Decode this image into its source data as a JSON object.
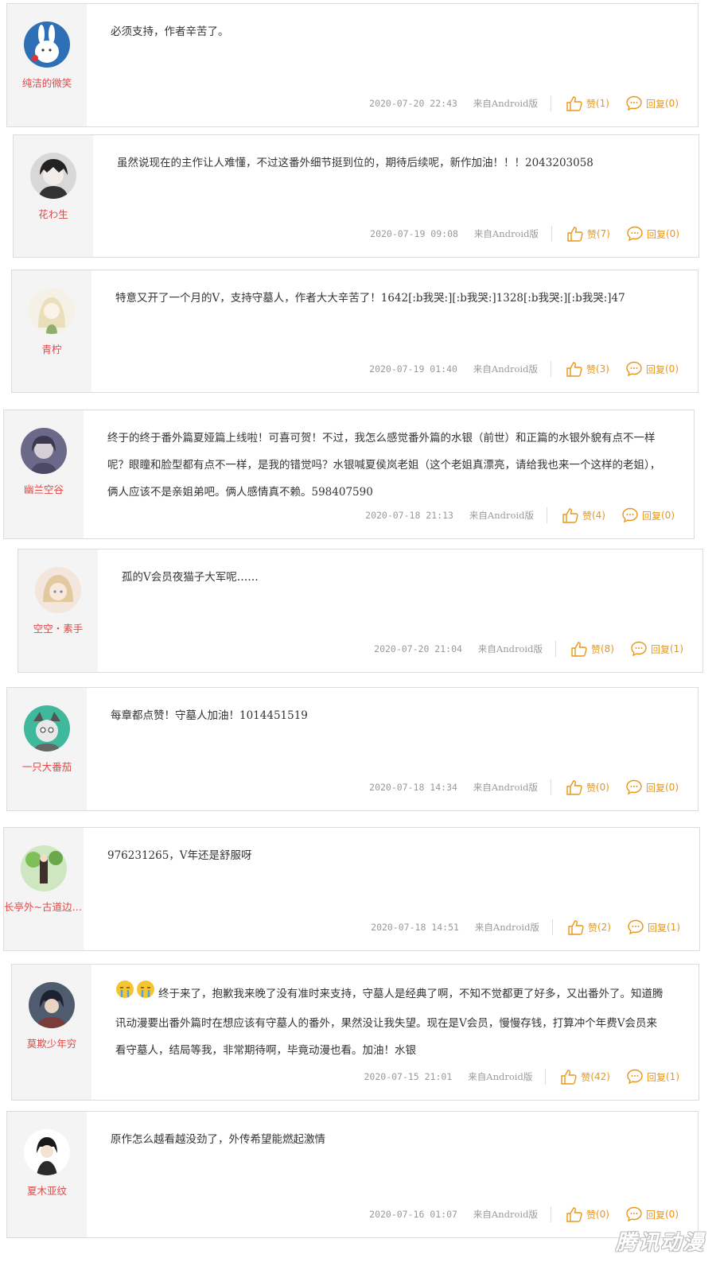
{
  "comments": [
    {
      "user": "纯洁的微笑",
      "text": "必须支持，作者辛苦了。",
      "time": "2020-07-20 22:43",
      "source": "来自Android版",
      "like_label": "赞",
      "like_count": "(1)",
      "reply_label": "回复",
      "reply_count": "(0)"
    },
    {
      "user": "花わ生",
      "text": "虽然说现在的主作让人难懂，不过这番外细节挺到位的，期待后续呢，新作加油！！！2043203058",
      "time": "2020-07-19 09:08",
      "source": "来自Android版",
      "like_label": "赞",
      "like_count": "(7)",
      "reply_label": "回复",
      "reply_count": "(0)"
    },
    {
      "user": "青柠",
      "text": "特意又开了一个月的V，支持守墓人，作者大大辛苦了！1642[:b我哭:][:b我哭:]1328[:b我哭:][:b我哭:]47",
      "time": "2020-07-19 01:40",
      "source": "来自Android版",
      "like_label": "赞",
      "like_count": "(3)",
      "reply_label": "回复",
      "reply_count": "(0)"
    },
    {
      "user": "幽兰空谷",
      "text": "终于的终于番外篇夏娅篇上线啦！可喜可贺！不过，我怎么感觉番外篇的水银（前世）和正篇的水银外貌有点不一样呢？眼瞳和脸型都有点不一样，是我的错觉吗？水银喊夏侯岚老姐（这个老姐真漂亮，请给我也来一个这样的老姐），俩人应该不是亲姐弟吧。俩人感情真不赖。598407590",
      "time": "2020-07-18 21:13",
      "source": "来自Android版",
      "like_label": "赞",
      "like_count": "(4)",
      "reply_label": "回复",
      "reply_count": "(0)"
    },
    {
      "user": "空空・素手",
      "text": "孤的V会员夜猫子大军呢……",
      "time": "2020-07-20 21:04",
      "source": "来自Android版",
      "like_label": "赞",
      "like_count": "(8)",
      "reply_label": "回复",
      "reply_count": "(1)"
    },
    {
      "user": "一只大番茄",
      "text": "每章都点赞！守墓人加油！1014451519",
      "time": "2020-07-18 14:34",
      "source": "来自Android版",
      "like_label": "赞",
      "like_count": "(0)",
      "reply_label": "回复",
      "reply_count": "(0)"
    },
    {
      "user": "长亭外~古道边~…",
      "text": "976231265，V年还是舒服呀",
      "time": "2020-07-18 14:51",
      "source": "来自Android版",
      "like_label": "赞",
      "like_count": "(2)",
      "reply_label": "回复",
      "reply_count": "(1)"
    },
    {
      "user": "莫欺少年穷",
      "text": "终于来了，抱歉我来晚了没有准时来支持，守墓人是经典了啊，不知不觉都更了好多，又出番外了。知道腾讯动漫要出番外篇时在想应该有守墓人的番外，果然没让我失望。现在是V会员，慢慢存钱，打算冲个年费V会员来看守墓人，结局等我，非常期待啊，毕竟动漫也看。加油！水银",
      "time": "2020-07-15 21:01",
      "source": "来自Android版",
      "like_label": "赞",
      "like_count": "(42)",
      "reply_label": "回复",
      "reply_count": "(1)"
    },
    {
      "user": "夏木亚纹",
      "text": "原作怎么越看越没劲了，外传希望能燃起激情",
      "time": "2020-07-16 01:07",
      "source": "来自Android版",
      "like_label": "赞",
      "like_count": "(0)",
      "reply_label": "回复",
      "reply_count": "(0)"
    }
  ],
  "watermark": "腾讯动漫",
  "colors": {
    "username": "#e04848",
    "action": "#e8961a",
    "meta": "#999999",
    "border": "#dcdcdc",
    "sidebar": "#f4f4f4"
  }
}
